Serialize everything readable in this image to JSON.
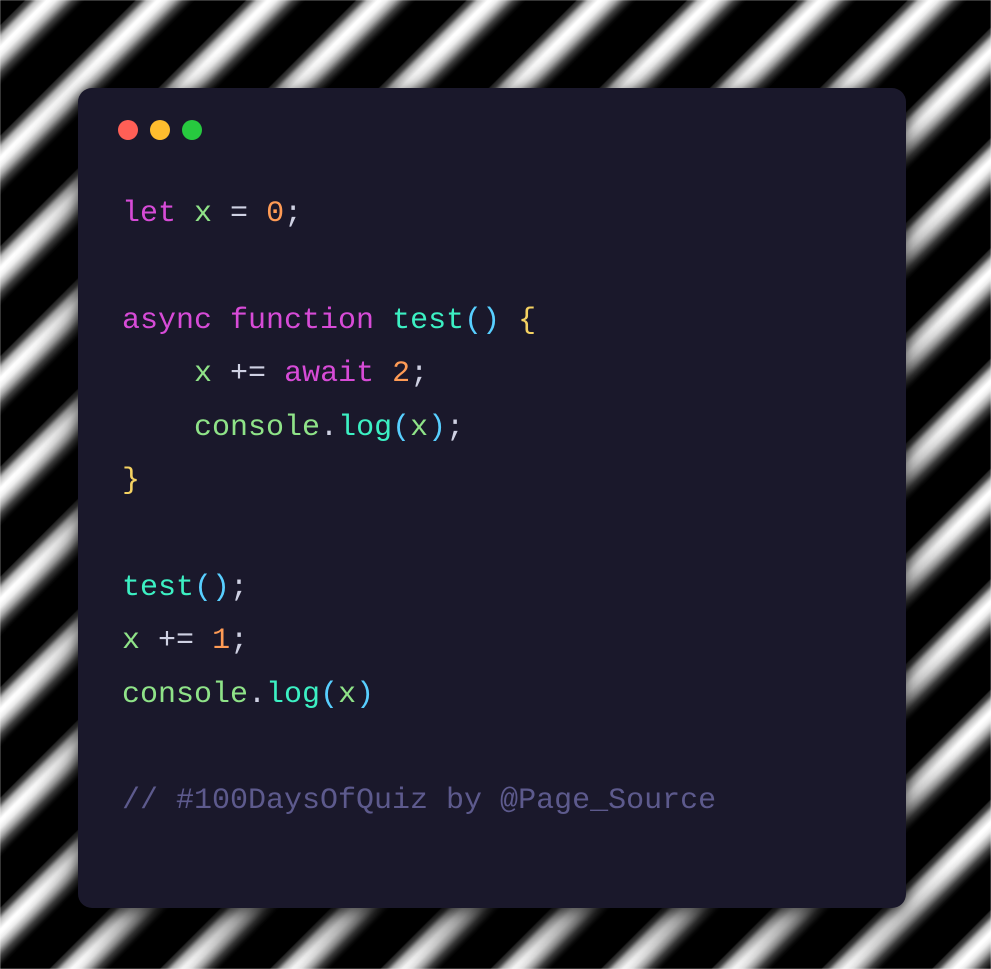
{
  "window": {
    "traffic": {
      "red": "#ff5f56",
      "yellow": "#ffbd2e",
      "green": "#27c93f"
    }
  },
  "code": {
    "l1": {
      "let": "let ",
      "x": "x",
      "sp1": " ",
      "eq": "=",
      "sp2": " ",
      "zero": "0",
      "semi": ";"
    },
    "l2_blank": "",
    "l3": {
      "async": "async ",
      "function": "function ",
      "name": "test",
      "lp": "(",
      "rp": ")",
      "sp": " ",
      "ob": "{"
    },
    "l4": {
      "indent": "    ",
      "x": "x",
      "sp1": " ",
      "op": "+=",
      "sp2": " ",
      "await": "await ",
      "two": "2",
      "semi": ";"
    },
    "l5": {
      "indent": "    ",
      "console": "console",
      "dot": ".",
      "log": "log",
      "lp": "(",
      "x": "x",
      "rp": ")",
      "semi": ";"
    },
    "l6": {
      "cb": "}"
    },
    "l7_blank": "",
    "l8": {
      "name": "test",
      "lp": "(",
      "rp": ")",
      "semi": ";"
    },
    "l9": {
      "x": "x",
      "sp1": " ",
      "op": "+=",
      "sp2": " ",
      "one": "1",
      "semi": ";"
    },
    "l10": {
      "console": "console",
      "dot": ".",
      "log": "log",
      "lp": "(",
      "x": "x",
      "rp": ")"
    },
    "l11_blank": "",
    "comment": "// #100DaysOfQuiz by @Page_Source"
  }
}
